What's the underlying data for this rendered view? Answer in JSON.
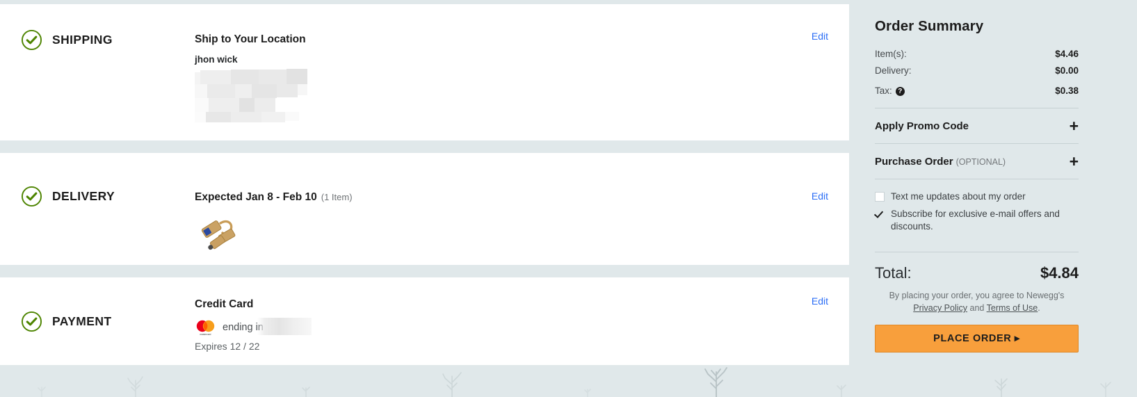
{
  "accent": {
    "check_green": "#4d8400",
    "link_blue": "#2b6ef6",
    "cta_orange": "#f89f3c",
    "page_bg": "#e0e8ea",
    "panel_bg": "#ffffff"
  },
  "sections": [
    {
      "id": "shipping",
      "step_label": "SHIPPING",
      "status_icon": "check-circle-icon",
      "title": "Ship to Your Location",
      "recipient": "jhon wick",
      "address_redacted": true,
      "edit_label": "Edit"
    },
    {
      "id": "delivery",
      "step_label": "DELIVERY",
      "status_icon": "check-circle-icon",
      "title": "Expected Jan 8 - Feb 10",
      "item_count": "(1 Item)",
      "product_thumb_alt": "usb-c-adapter-cable-thumbnail",
      "edit_label": "Edit"
    },
    {
      "id": "payment",
      "step_label": "PAYMENT",
      "status_icon": "check-circle-icon",
      "title": "Credit Card",
      "card_brand_icon": "mastercard-icon",
      "card_ending_text": "ending in",
      "card_digits_redacted": true,
      "expires": "Expires 12 / 22",
      "edit_label": "Edit"
    }
  ],
  "summary": {
    "title": "Order Summary",
    "lines": [
      {
        "label": "Item(s):",
        "value": "$4.46",
        "has_info_icon": false
      },
      {
        "label": "Delivery:",
        "value": "$0.00",
        "has_info_icon": false
      },
      {
        "label": "Tax:",
        "value": "$0.38",
        "has_info_icon": true,
        "info_icon": "question-mark-icon"
      }
    ],
    "promo": {
      "label": "Apply Promo Code",
      "expand_icon": "plus-icon"
    },
    "purchase_order": {
      "label": "Purchase Order",
      "optional_label": "(OPTIONAL)",
      "expand_icon": "plus-icon"
    },
    "options": [
      {
        "label": "Text me updates about my order",
        "checked": false
      },
      {
        "label": "Subscribe for exclusive e-mail offers and discounts.",
        "checked": true
      }
    ],
    "total": {
      "label": "Total:",
      "value": "$4.84"
    },
    "legal": {
      "prefix": "By placing your order, you agree to Newegg's",
      "privacy_link": "Privacy Policy",
      "conjunction": "and",
      "terms_link": "Terms of Use",
      "suffix": "."
    },
    "place_order_label": "PLACE ORDER ▸"
  }
}
